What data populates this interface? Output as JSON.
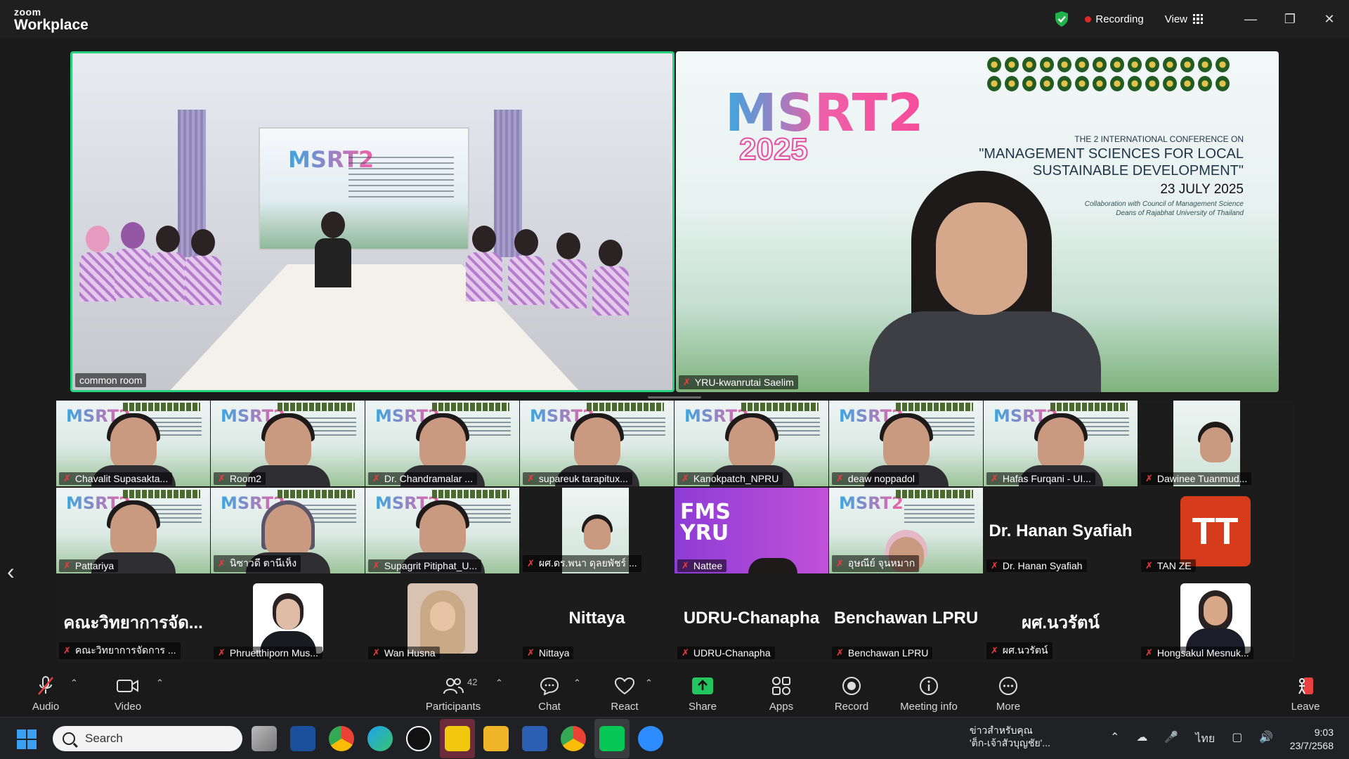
{
  "app": {
    "brand_small": "zoom",
    "brand_big": "Workplace"
  },
  "titlebar": {
    "recording_label": "Recording",
    "view_label": "View"
  },
  "speakers": [
    {
      "name": "common room"
    },
    {
      "name": "YRU-kwanrutai Saelim"
    }
  ],
  "conference": {
    "logo_text": "MSRT2",
    "year": "2025",
    "line1": "THE 2 INTERNATIONAL CONFERENCE ON",
    "line2": "\"MANAGEMENT SCIENCES FOR LOCAL",
    "line3": "SUSTAINABLE DEVELOPMENT\"",
    "date": "23 JULY 2025",
    "collab1": "Collaboration with Council of Management Science",
    "collab2": "Deans of Rajabhat University of Thailand"
  },
  "gallery": {
    "row1": [
      {
        "name": "Chavalit Supasakta..."
      },
      {
        "name": "Room2"
      },
      {
        "name": "Dr. Chandramalar ..."
      },
      {
        "name": "supareuk tarapitux..."
      },
      {
        "name": "Kanokpatch_NPRU"
      },
      {
        "name": "deaw noppadol"
      },
      {
        "name": "Hafas Furqani - UI..."
      },
      {
        "name": "Dawinee Tuanmud..."
      }
    ],
    "row2": [
      {
        "name": "Pattariya"
      },
      {
        "name": "นิซาวดี ตานีเห็ง"
      },
      {
        "name": "Supagrit Pitiphat_U..."
      },
      {
        "name": "ผศ.ดร.พนา ดุลยพัชร์ ..."
      },
      {
        "name": "Nattee",
        "card": "FMS\nYRU"
      },
      {
        "name": "อุษณีย์ จุนหมาก"
      },
      {
        "name": "Dr. Hanan Syafiah",
        "big": "Dr. Hanan Syafiah"
      },
      {
        "name": "TAN ZE",
        "initials": "TT"
      }
    ],
    "row3": [
      {
        "name": "คณะวิทยาการจัดการ ...",
        "big": "คณะวิทยาการจัด..."
      },
      {
        "name": "Phruetthiporn Mus..."
      },
      {
        "name": "Wan Husna"
      },
      {
        "name": "Nittaya",
        "big": "Nittaya"
      },
      {
        "name": "UDRU-Chanapha",
        "big": "UDRU-Chanapha"
      },
      {
        "name": "Benchawan LPRU",
        "big": "Benchawan LPRU"
      },
      {
        "name": "ผศ.นวรัตน์",
        "big": "ผศ.นวรัตน์"
      },
      {
        "name": "Hongsakul Mesnuk..."
      }
    ]
  },
  "toolbar": {
    "audio": "Audio",
    "video": "Video",
    "participants": "Participants",
    "participants_count": "42",
    "chat": "Chat",
    "react": "React",
    "share": "Share",
    "apps": "Apps",
    "record": "Record",
    "meeting_info": "Meeting info",
    "more": "More",
    "leave": "Leave"
  },
  "taskbar": {
    "search_placeholder": "Search",
    "news_title": "ข่าวสำหรับคุณ",
    "news_sub": "'ต็ก-เจ้าสัวบุญชัย'...",
    "lang": "ไทย",
    "time": "9:03",
    "date": "23/7/2568"
  },
  "colors": {
    "active_speaker_border": "#27d17f",
    "mute_red": "#e94040",
    "share_green": "#22c55e",
    "rec_red": "#e02828"
  }
}
